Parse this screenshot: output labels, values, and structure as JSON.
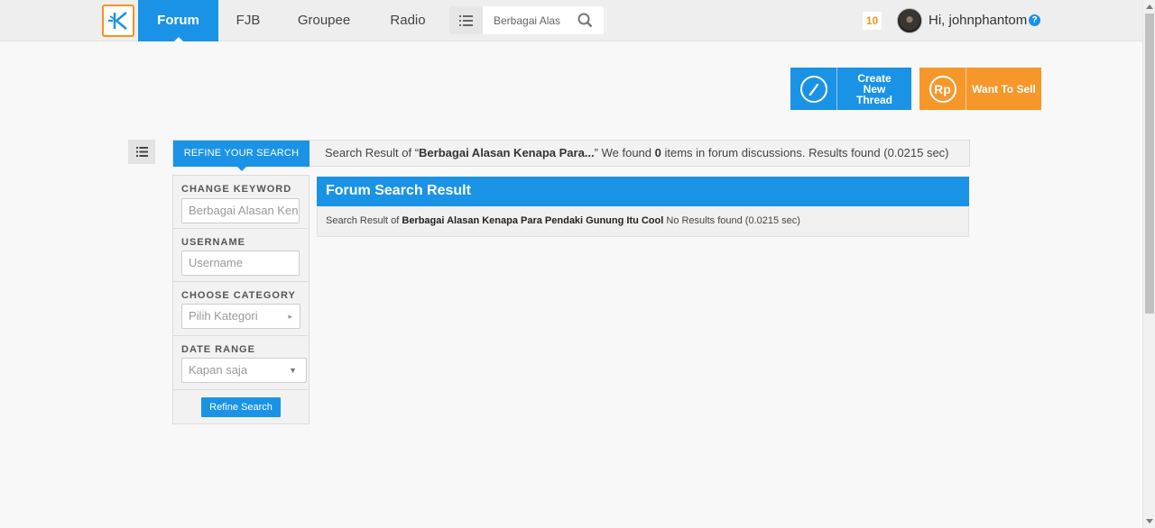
{
  "nav": {
    "items": [
      {
        "label": "Forum"
      },
      {
        "label": "FJB"
      },
      {
        "label": "Groupee"
      },
      {
        "label": "Radio"
      }
    ],
    "search_value": "Berbagai Alas",
    "notification_count": "10",
    "greeting": "Hi, johnphantom",
    "help_glyph": "?"
  },
  "actions": {
    "create_thread": "Create New Thread",
    "want_to_sell": "Want To Sell",
    "sell_icon_text": "Rp"
  },
  "refine": {
    "tab_label": "REFINE YOUR SEARCH",
    "summary_prefix": "Search Result of “",
    "summary_keyword": "Berbagai Alasan Kenapa Para...",
    "summary_mid": "” We found ",
    "summary_count": "0",
    "summary_suffix": " items in forum discussions. Results found (0.0215 sec)"
  },
  "filters": {
    "keyword_label": "CHANGE KEYWORD",
    "keyword_value": "Berbagai Alasan Kenapa Para Pendaki Gunung Itu Cool",
    "username_label": "USERNAME",
    "username_placeholder": "Username",
    "category_label": "CHOOSE CATEGORY",
    "category_value": "Pilih Kategori",
    "date_label": "DATE RANGE",
    "date_value": "Kapan saja",
    "refine_button": "Refine Search"
  },
  "results": {
    "title": "Forum Search Result",
    "prefix": "Search Result of ",
    "keyword": "Berbagai Alasan Kenapa Para Pendaki Gunung Itu Cool",
    "suffix": " No Results found (0.0215 sec)"
  },
  "colors": {
    "primary": "#1a93e6",
    "accent": "#f6972a"
  }
}
